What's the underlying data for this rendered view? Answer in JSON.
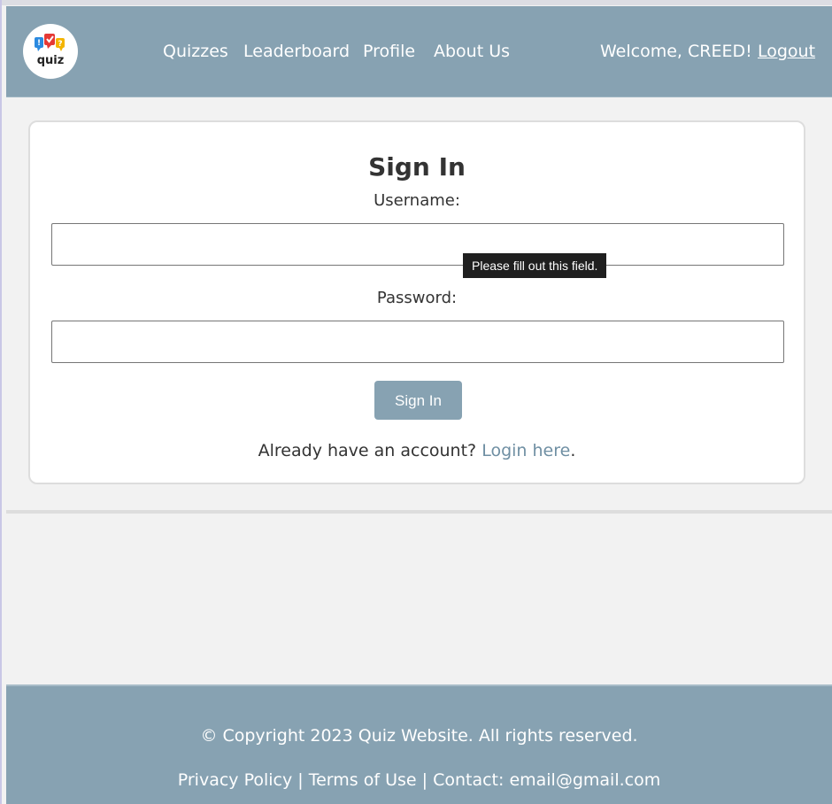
{
  "header": {
    "logo_text": "quiz",
    "nav": [
      {
        "label": "Quizzes"
      },
      {
        "label": "Leaderboard"
      },
      {
        "label": "Profile"
      },
      {
        "label": "About Us"
      }
    ],
    "welcome": "Welcome, CREED!",
    "logout": "Logout"
  },
  "form": {
    "title": "Sign In",
    "username_label": "Username:",
    "username_value": "",
    "password_label": "Password:",
    "password_value": "",
    "validation_tooltip": "Please fill out this field.",
    "submit_label": "Sign In",
    "account_prompt": "Already have an account?",
    "login_link": "Login here",
    "prompt_end": "."
  },
  "footer": {
    "copyright": "© Copyright 2023 Quiz Website. All rights reserved.",
    "privacy": "Privacy Policy",
    "terms": "Terms of Use",
    "separator": "|",
    "contact": "Contact: email@gmail.com"
  },
  "colors": {
    "brand": "#87a2b2",
    "link": "#6f8fa3",
    "text": "#333333",
    "background": "#f2f2f2"
  }
}
